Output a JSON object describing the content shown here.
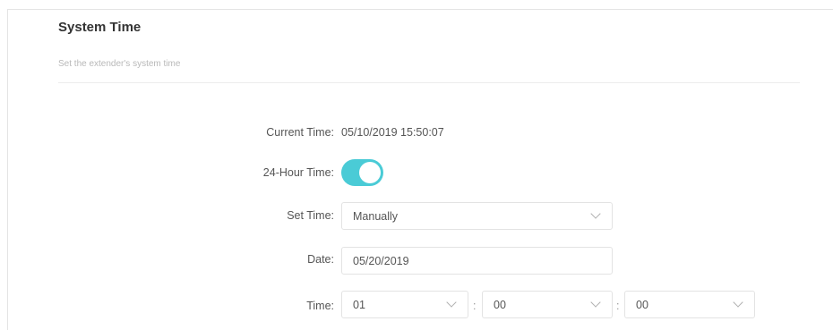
{
  "section": {
    "title": "System Time",
    "subtitle": "Set the extender's system time"
  },
  "current_time": {
    "label": "Current Time:",
    "value": "05/10/2019 15:50:07"
  },
  "hour24": {
    "label": "24-Hour Time:",
    "enabled": true
  },
  "set_time": {
    "label": "Set Time:",
    "value": "Manually"
  },
  "date": {
    "label": "Date:",
    "value": "05/20/2019"
  },
  "time": {
    "label": "Time:",
    "hour": "01",
    "minute": "00",
    "second": "00",
    "separator": ":"
  },
  "colors": {
    "accent": "#4acbd6",
    "border": "#e3e3e3",
    "text": "#555555"
  }
}
